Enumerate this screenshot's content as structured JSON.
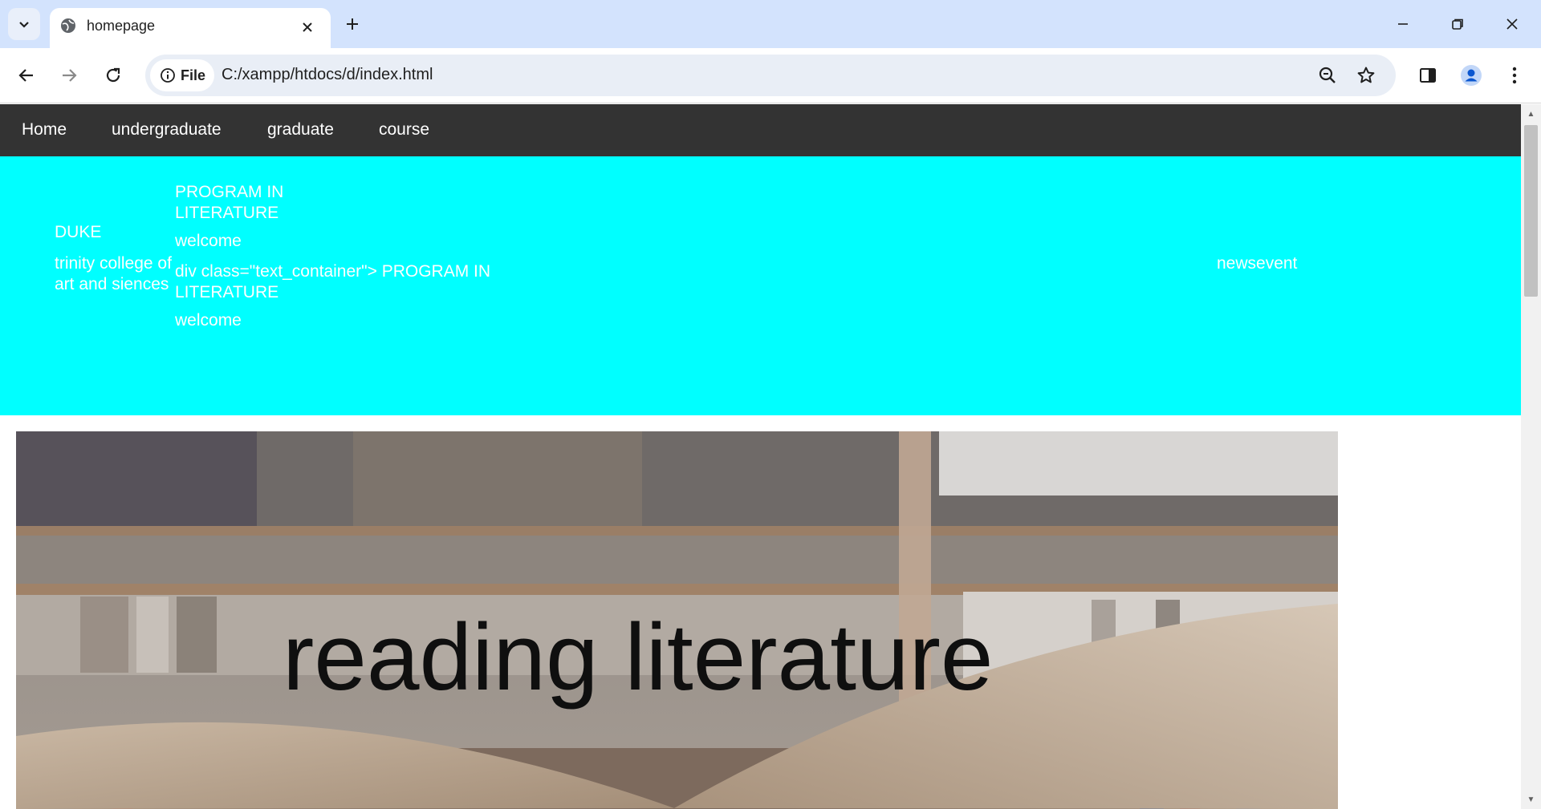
{
  "browser": {
    "tab_title": "homepage",
    "site_chip_label": "File",
    "url": "C:/xampp/htdocs/d/index.html"
  },
  "icons": {
    "tab_search": "chevron-down-icon",
    "favicon": "globe-icon",
    "tab_close": "close-icon",
    "new_tab": "plus-icon",
    "back": "arrow-left-icon",
    "forward": "arrow-right-icon",
    "reload": "reload-icon",
    "info": "info-icon",
    "zoom": "zoom-icon",
    "bookmark": "star-icon",
    "side_panel": "side-panel-icon",
    "profile": "profile-icon",
    "menu": "kebab-menu-icon",
    "minimize": "minimize-icon",
    "restore": "restore-icon",
    "close_window": "close-icon"
  },
  "nav": {
    "items": [
      {
        "label": "Home"
      },
      {
        "label": "undergraduate"
      },
      {
        "label": "graduate"
      },
      {
        "label": "course"
      }
    ]
  },
  "hero": {
    "brand": "DUKE",
    "college_line1": "trinity college of",
    "college_line2": "art and siences",
    "program_line1": "PROGRAM IN",
    "program_line2": "LITERATURE",
    "welcome": "welcome",
    "dup_program_line1": "div class=\"text_container\"> PROGRAM IN",
    "dup_program_line2": "LITERATURE",
    "dup_welcome": "welcome",
    "newsevent": "newsevent"
  },
  "banner": {
    "caption": "reading literature"
  },
  "colors": {
    "tabstrip": "#d3e3fd",
    "nav_bg": "#333333",
    "hero_bg": "#00ffff",
    "hero_text": "#ffffff"
  }
}
